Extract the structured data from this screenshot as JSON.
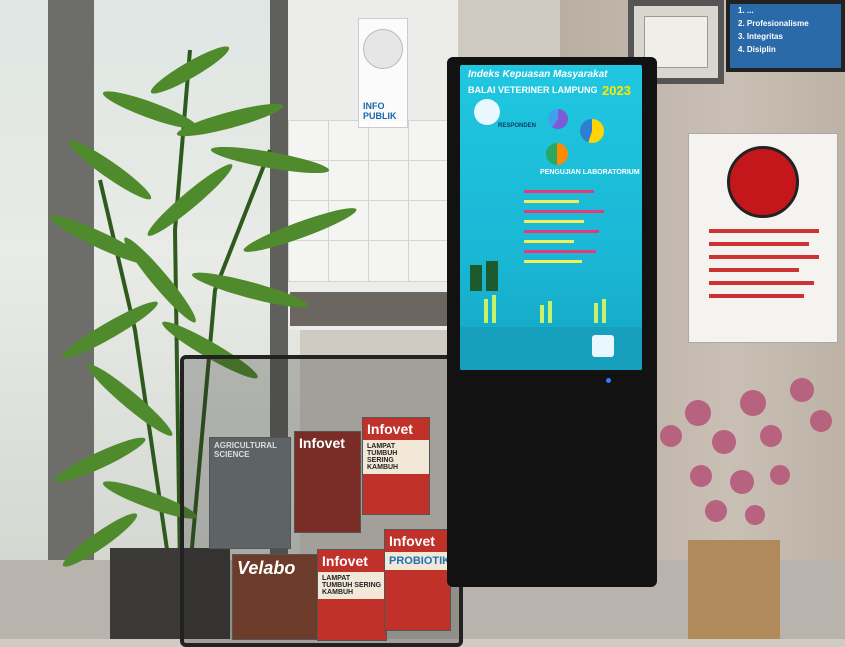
{
  "kiosk": {
    "title": "Indeks Kepuasan Masyarakat",
    "subtitle": "BALAI VETERINER LAMPUNG",
    "year": "2023",
    "section_respondents": "RESPONDEN",
    "section_lab": "PENGUJIAN LABORATORIUM"
  },
  "magazines": {
    "rack_left_title": "AGRICULTURAL SCIENCE",
    "top_middle": "Infovet",
    "top_right": "Infovet",
    "top_right_caption": "LAMPAT TUMBUH SERING KAMBUH",
    "bottom_left": "Velabo",
    "bottom_middle": "Infovet",
    "bottom_middle_caption": "LAMPAT TUMBUH SERING KAMBUH",
    "bottom_right": "Infovet",
    "bottom_right_caption": "PROBIOTIK"
  },
  "wall": {
    "cert_lines": [
      "1. ...",
      "2. Profesionalisme",
      "3. Integritas",
      "4. Disiplin"
    ],
    "sign_text": "INFO PUBLIK"
  },
  "colors": {
    "screen": "#1ab8d6",
    "accent_yellow": "#ffe600",
    "rack_frame": "#222222"
  }
}
